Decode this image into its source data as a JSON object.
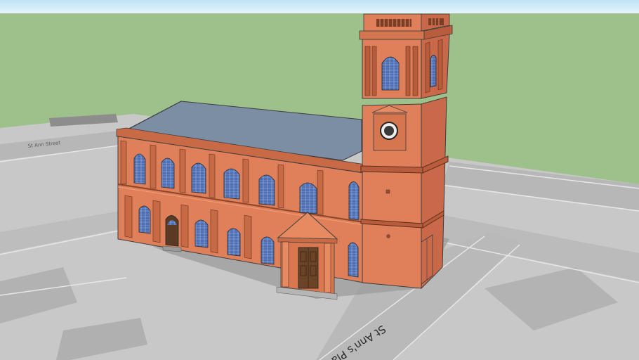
{
  "scene": {
    "street_label": "St Ann's Place",
    "faint_label": "St Ann Street",
    "colors": {
      "sky": "#d8ecf6",
      "grass": "#9ec08a",
      "ground": "#c9c9c9",
      "road": "#b4b4b4",
      "shadow": "#999999",
      "brick": "#e0805a",
      "brick_dark": "#b85c3c",
      "brick_light": "#ee9670",
      "roof": "#7a8fa3",
      "window": "#4f6fb4",
      "door": "#5a3a22"
    }
  }
}
